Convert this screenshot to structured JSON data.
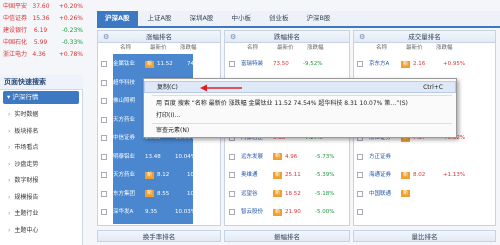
{
  "tickers": [
    {
      "name": "中国平安",
      "price": "37.60",
      "change": "+0.20%",
      "up": true
    },
    {
      "name": "中信证券",
      "price": "15.36",
      "change": "+0.26%",
      "up": true
    },
    {
      "name": "建设银行",
      "price": "6.19",
      "change": "-0.23%",
      "up": false
    },
    {
      "name": "中国石化",
      "price": "5.99",
      "change": "-0.33%",
      "up": false
    },
    {
      "name": "浙江电力",
      "price": "4.36",
      "change": "+0.78%",
      "up": true
    }
  ],
  "left": {
    "title": "页面快速搜索",
    "subtitle": "沪深行情",
    "items": [
      "实时数据",
      "板块排名",
      "市场看点",
      "沙盘走势",
      "数字财报",
      "规模报告",
      "主题行业",
      "主题中心"
    ]
  },
  "tabs": [
    "沪深A股",
    "上证A股",
    "深圳A股",
    "中小板",
    "创业板",
    "沪深B股"
  ],
  "panels": {
    "left_title": "涨幅排名",
    "middle_title": "跌幅排名",
    "right_title": "成交量排名",
    "bottom_left": "换手率排名",
    "bottom_mid": "振幅排名",
    "bottom_right": "量比排名"
  },
  "columns": {
    "name": "名称",
    "price": "最新价",
    "change": "涨跌幅"
  },
  "left_rows": [
    {
      "name": "金属钛业",
      "badge": "新",
      "price": "11.52",
      "change": "74.54%"
    },
    {
      "name": "超华科技",
      "badge": "",
      "price": "8.31",
      "change": "10.07%"
    },
    {
      "name": "佛山照明",
      "badge": "",
      "price": "7.02",
      "change": "10.06%"
    },
    {
      "name": "天方药业",
      "badge": "",
      "price": "5.56",
      "change": "10.05%"
    },
    {
      "name": "中信证券",
      "badge": "",
      "price": "16.38",
      "change": "10.06%"
    },
    {
      "name": "明泰铝业",
      "badge": "",
      "price": "13.48",
      "change": "10.04%"
    },
    {
      "name": "天方药业",
      "badge": "新",
      "price": "8.12",
      "change": "10.04%"
    },
    {
      "name": "东方集团",
      "badge": "新",
      "price": "8.55",
      "change": "10.04%"
    },
    {
      "name": "深华发A",
      "badge": "",
      "price": "9.35",
      "change": "10.03%"
    }
  ],
  "mid_rows": [
    {
      "name": "富瑞特装",
      "badge": "",
      "price": "73.50",
      "change": "-9.52%"
    },
    {
      "name": "",
      "badge": "",
      "price": "",
      "change": ""
    },
    {
      "name": "",
      "badge": "",
      "price": "",
      "change": ""
    },
    {
      "name": "",
      "badge": "",
      "price": "",
      "change": ""
    },
    {
      "name": "内蒙君正",
      "badge": "",
      "price": "6.38",
      "change": "-7.27%"
    },
    {
      "name": "远东发展",
      "badge": "新",
      "price": "4.96",
      "change": "-5.73%"
    },
    {
      "name": "奥维通",
      "badge": "新",
      "price": "25.11",
      "change": "-5.39%"
    },
    {
      "name": "远望谷",
      "badge": "新",
      "price": "18.52",
      "change": "-5.18%"
    },
    {
      "name": "智云股份",
      "badge": "新",
      "price": "21.90",
      "change": "-5.00%"
    }
  ],
  "right_rows": [
    {
      "name": "京东方A",
      "badge": "新",
      "price": "2.16",
      "change": "+0.95%"
    },
    {
      "name": "",
      "badge": "",
      "price": "",
      "change": ""
    },
    {
      "name": "",
      "badge": "",
      "price": "",
      "change": ""
    },
    {
      "name": "",
      "badge": "",
      "price": "",
      "change": ""
    },
    {
      "name": "浙江证券",
      "badge": "新",
      "price": "7.37",
      "change": "+0.82%"
    },
    {
      "name": "方正证券",
      "badge": "",
      "price": "",
      "change": ""
    },
    {
      "name": "海通证券",
      "badge": "新",
      "price": "8.02",
      "change": "+1.13%"
    },
    {
      "name": "中国联通",
      "badge": "新",
      "price": "",
      "change": ""
    },
    {
      "name": "",
      "badge": "",
      "price": "",
      "change": ""
    }
  ],
  "context_menu": {
    "copy": "复制(C)",
    "copy_shortcut": "Ctrl+C",
    "search": "用 百度 搜索 “名称 最新价 涨跌幅 金属钛业 11.52 74.54% 超华科技 8.31 10.07% 第…”(S)",
    "print": "打印(I)...",
    "inspect": "审查元素(N)"
  }
}
